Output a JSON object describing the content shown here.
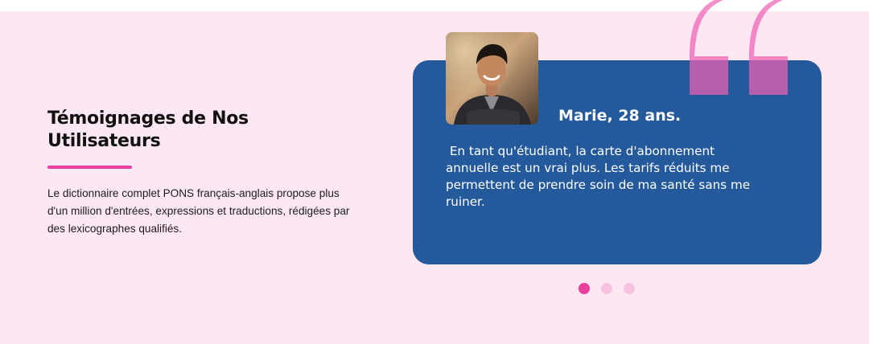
{
  "testimonials": {
    "heading": "Témoignages de Nos Utilisateurs",
    "description": "Le dictionnaire complet PONS français-anglais propose plus d'un million d'entrées, expressions et traductions, rédigées par des lexicographes qualifiés.",
    "active": {
      "author": "Marie, 28 ans.",
      "quote": " En tant qu'étudiant, la carte d'abonnement annuelle est un vrai plus. Les tarifs réduits me permettent de prendre soin de ma santé sans me ruiner.",
      "avatar_icon": "user-portrait-photo"
    },
    "slides_total": 3,
    "slide_active_index": 0
  },
  "colors": {
    "page_bg": "#fde7f3",
    "accent": "#e83e9c",
    "card_bg": "#245a9c",
    "quote_mark": "#ee62b4",
    "dot_inactive": "#f7c3e0"
  },
  "icons": {
    "quote_mark": "quote-mark-icon"
  }
}
